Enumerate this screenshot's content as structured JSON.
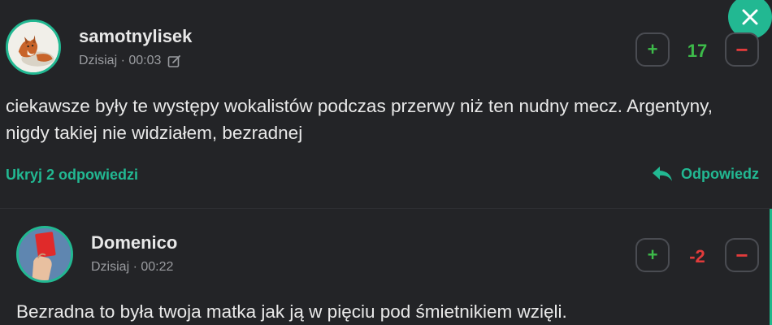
{
  "colors": {
    "background": "#232427",
    "accent": "#22b892",
    "positive": "#3dbb4a",
    "negative": "#e23b3b",
    "muted": "#9a9ca0"
  },
  "close_button": {
    "icon": "close-icon"
  },
  "comments": [
    {
      "username": "samotnylisek",
      "timestamp": "Dzisiaj · 00:03",
      "edited_icon": "edit-icon",
      "avatar": "fox-avatar",
      "text": "ciekawsze były te występy wokalistów podczas przerwy niż ten nudny mecz. Argentyny, nigdy takiej nie widziałem, bezradnej",
      "score": "17",
      "upvote_label": "+",
      "downvote_label": "−",
      "hide_replies_label": "Ukryj 2 odpowiedzi",
      "reply_label": "Odpowiedz"
    },
    {
      "username": "Domenico",
      "timestamp": "Dzisiaj · 00:22",
      "avatar": "red-card-avatar",
      "text": "Bezradna to była twoja matka jak ją w pięciu pod śmietnikiem wzięli.",
      "score": "-2",
      "upvote_label": "+",
      "downvote_label": "−"
    }
  ]
}
